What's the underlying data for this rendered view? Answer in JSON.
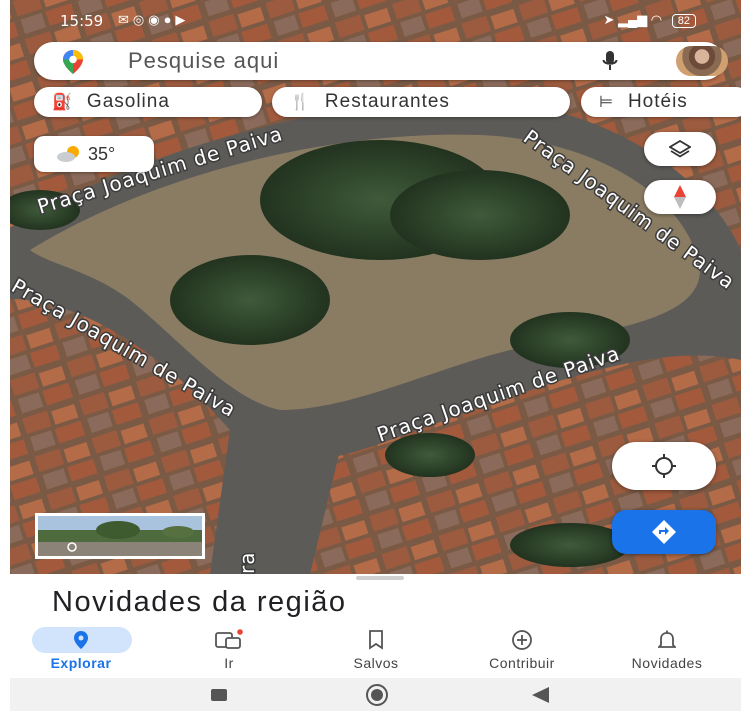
{
  "status_bar": {
    "time": "15:59",
    "battery": "82"
  },
  "search": {
    "placeholder": "Pesquise aqui"
  },
  "chips": [
    {
      "label": "Gasolina",
      "icon": "gas-station-icon"
    },
    {
      "label": "Restaurantes",
      "icon": "restaurant-icon"
    },
    {
      "label": "Hotéis",
      "icon": "hotel-icon"
    }
  ],
  "weather": {
    "temperature": "35°",
    "icon": "partly-cloudy-icon"
  },
  "map": {
    "street_labels": [
      "Praça Joaquim de Paiva",
      "Praça Joaquim de Paiva",
      "Praça Joaquim de Paiva",
      "Praça Joaquim de Paiva"
    ],
    "partial_label": "ra"
  },
  "bottom_sheet": {
    "title": "Novidades da região"
  },
  "bottom_nav": [
    {
      "label": "Explorar",
      "icon": "explore-pin-icon",
      "active": true
    },
    {
      "label": "Ir",
      "icon": "commute-icon",
      "active": false
    },
    {
      "label": "Salvos",
      "icon": "bookmark-icon",
      "active": false
    },
    {
      "label": "Contribuir",
      "icon": "add-circle-icon",
      "active": false
    },
    {
      "label": "Novidades",
      "icon": "bell-icon",
      "active": false
    }
  ],
  "colors": {
    "accent": "#1a73e8",
    "active_pill": "#d2e3fc",
    "compass_red": "#ea4335"
  }
}
